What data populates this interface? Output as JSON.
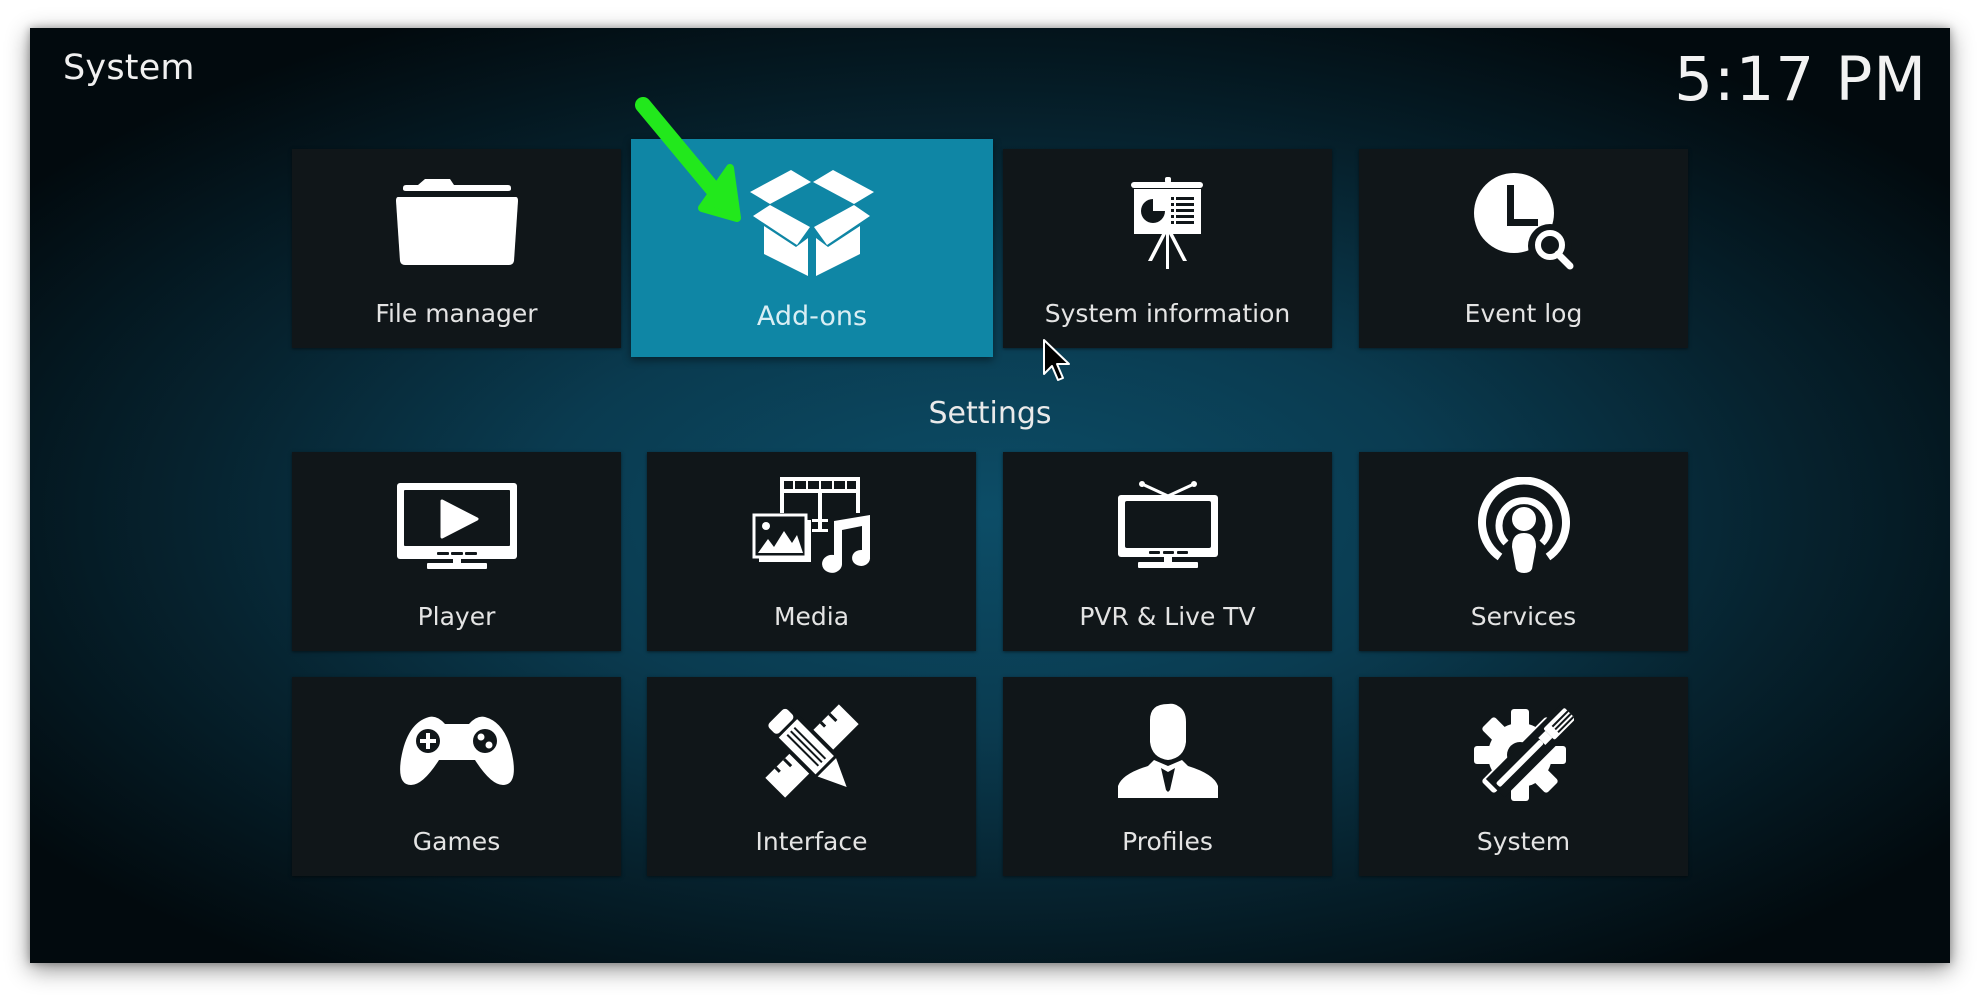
{
  "header": {
    "title": "System",
    "clock": "5:17 PM"
  },
  "top_row": [
    {
      "id": "file-manager",
      "label": "File manager",
      "icon": "folder-icon",
      "focused": false
    },
    {
      "id": "add-ons",
      "label": "Add-ons",
      "icon": "open-box-icon",
      "focused": true
    },
    {
      "id": "system-information",
      "label": "System information",
      "icon": "presentation-easel-icon",
      "focused": false
    },
    {
      "id": "event-log",
      "label": "Event log",
      "icon": "clock-search-icon",
      "focused": false
    }
  ],
  "settings": {
    "heading": "Settings",
    "items": [
      {
        "id": "player",
        "label": "Player",
        "icon": "monitor-play-icon"
      },
      {
        "id": "media",
        "label": "Media",
        "icon": "media-icon"
      },
      {
        "id": "pvr-live-tv",
        "label": "PVR & Live TV",
        "icon": "tv-antenna-icon"
      },
      {
        "id": "services",
        "label": "Services",
        "icon": "broadcast-icon"
      },
      {
        "id": "games",
        "label": "Games",
        "icon": "gamepad-icon"
      },
      {
        "id": "interface",
        "label": "Interface",
        "icon": "pencil-ruler-icon"
      },
      {
        "id": "profiles",
        "label": "Profiles",
        "icon": "user-profile-icon"
      },
      {
        "id": "system",
        "label": "System",
        "icon": "gear-wrench-icon"
      }
    ]
  },
  "annotation": {
    "arrow_color": "#22e81c",
    "target": "add-ons"
  },
  "colors": {
    "focus_tile": "#0f86a5",
    "tile": "#101619",
    "text": "#e4e4e4"
  }
}
